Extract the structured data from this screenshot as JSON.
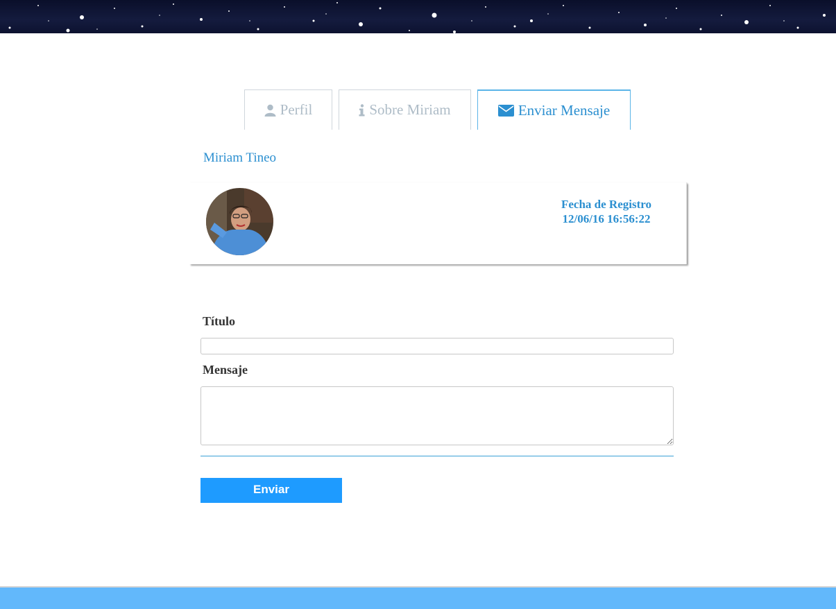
{
  "header": {
    "banner": "starry-sky-banner"
  },
  "tabs": [
    {
      "label": "Perfil",
      "icon": "user-icon",
      "active": false
    },
    {
      "label": "Sobre Miriam",
      "icon": "info-icon",
      "active": false
    },
    {
      "label": "Enviar Mensaje",
      "icon": "envelope-icon",
      "active": true
    }
  ],
  "profile": {
    "name": "Miriam Tineo",
    "avatar": "profile-photo",
    "registration_label": "Fecha de Registro",
    "registration_date": "12/06/16 16:56:22"
  },
  "form": {
    "title_label": "Título",
    "title_value": "",
    "message_label": "Mensaje",
    "message_value": "",
    "submit_label": "Enviar"
  },
  "colors": {
    "accent": "#2b8fd0",
    "button": "#1e9bff",
    "footer": "#62b8fb",
    "tab_inactive": "#aebcc7"
  }
}
